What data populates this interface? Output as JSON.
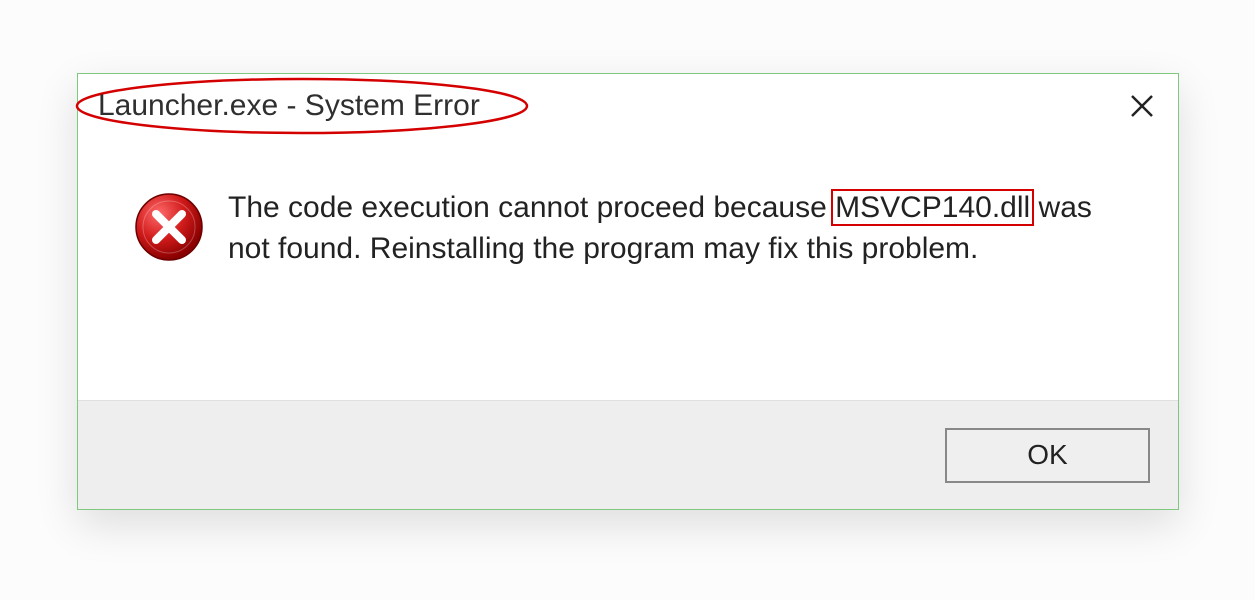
{
  "dialog": {
    "title": "Launcher.exe - System Error",
    "close_glyph": "✕",
    "message_part1": "The code execution cannot proceed because ",
    "message_dll": "MSVCP140.dll",
    "message_part2": " was not found. Reinstalling the program may fix this problem.",
    "ok_label": "OK"
  },
  "annotations": {
    "title_ellipse": true,
    "dll_box": true
  },
  "colors": {
    "annotation_red": "#d40000",
    "dialog_border": "#7ec97e",
    "icon_red_dark": "#a10000",
    "icon_red_light": "#e33b3b"
  }
}
